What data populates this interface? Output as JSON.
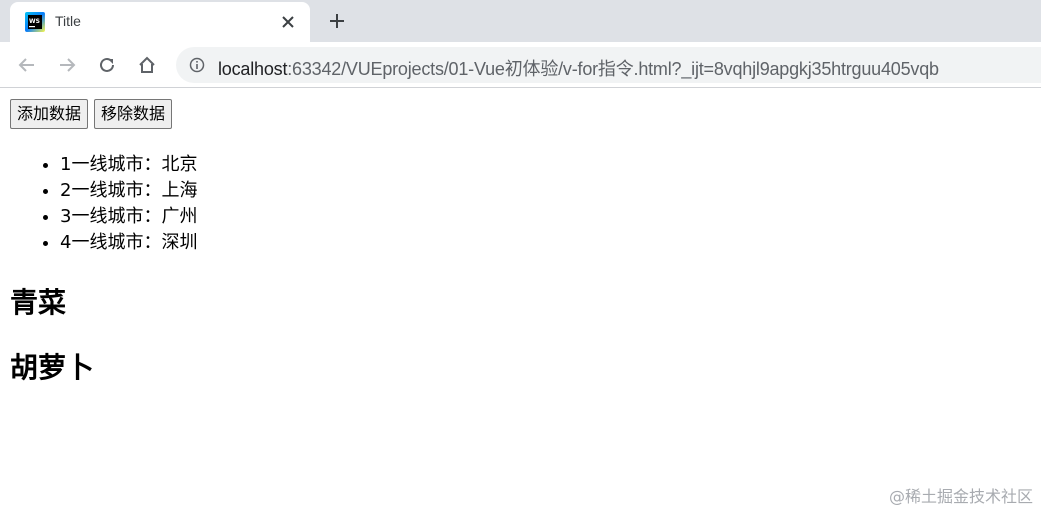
{
  "browser": {
    "tab_title": "Title",
    "url_host": "localhost",
    "url_path": ":63342/VUEprojects/01-Vue初体验/v-for指令.html?_ijt=8vqhjl9apgkj35htrguu405vqb"
  },
  "page": {
    "buttons": {
      "add": "添加数据",
      "remove": "移除数据"
    },
    "cities": [
      "1一线城市：北京",
      "2一线城市：上海",
      "3一线城市：广州",
      "4一线城市：深圳"
    ],
    "headings": [
      "青菜",
      "胡萝卜"
    ],
    "watermark": "@稀土掘金技术社区"
  }
}
